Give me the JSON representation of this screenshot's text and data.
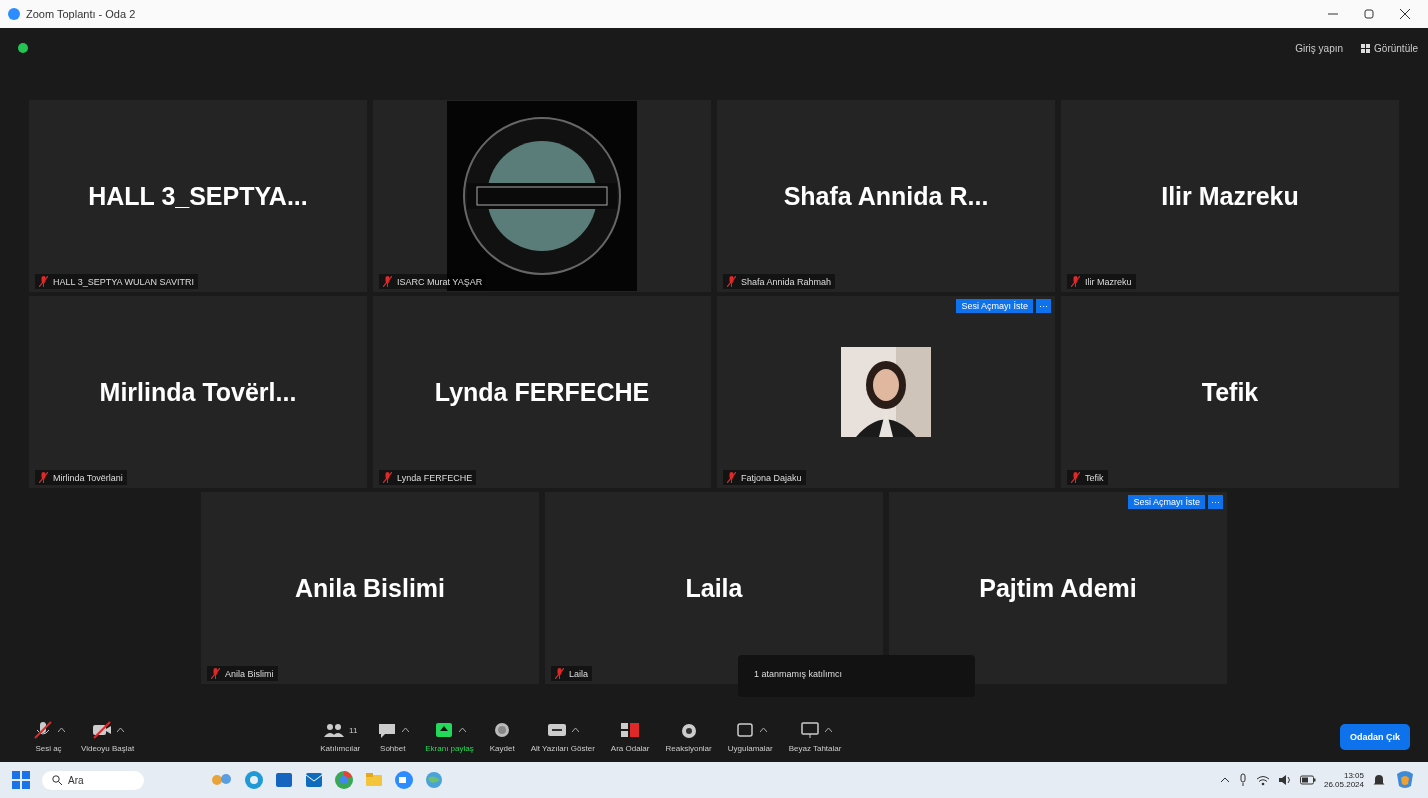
{
  "window": {
    "title": "Zoom Toplantı - Oda 2"
  },
  "top_bar": {
    "sign_in": "Giriş yapın",
    "view": "Görüntüle"
  },
  "rows": [
    [
      {
        "kind": "name",
        "display": "HALL 3_SEPTYA...",
        "label": "HALL 3_SEPTYA WULAN SAVITRI",
        "muted": true
      },
      {
        "kind": "picture",
        "label": "ISARC Murat YAŞAR",
        "muted": true
      },
      {
        "kind": "name",
        "display": "Shafa Annida R...",
        "label": "Shafa Annida Rahmah",
        "muted": true
      },
      {
        "kind": "name",
        "display": "Ilir Mazreku",
        "label": "Ilir Mazreku",
        "muted": true
      }
    ],
    [
      {
        "kind": "name",
        "display": "Mirlinda Tovërl...",
        "label": "Mirlinda Tovërlani",
        "muted": true
      },
      {
        "kind": "name",
        "display": "Lynda FERFECHE",
        "label": "Lynda FERFECHE",
        "muted": true
      },
      {
        "label": "Fatjona Dajaku",
        "muted": true,
        "ask_button": "Sesi Açmayı İste",
        "more": "···"
      },
      {
        "kind": "name",
        "display": "Tefik",
        "label": "Tefik",
        "muted": true
      }
    ],
    [
      {
        "kind": "name",
        "display": "Anila Bislimi",
        "label": "Anila Bislimi",
        "muted": true
      },
      {
        "kind": "name",
        "display": "Laila",
        "label": "Laila",
        "muted": true
      },
      {
        "kind": "name",
        "display": "Pajtim Ademi",
        "ask_button": "Sesi Açmayı İste",
        "more": "···"
      }
    ]
  ],
  "tooltip": "1 atanmamış katılımcı",
  "toolbar": [
    {
      "kind": "mic",
      "label": "Sesi aç",
      "caret": true
    },
    {
      "kind": "video",
      "label": "Videoyu Başlat",
      "caret": true
    },
    {
      "kind": "gap"
    },
    {
      "kind": "people",
      "label": "Katılımcılar",
      "count": "11",
      "caret": false
    },
    {
      "kind": "chat",
      "label": "Sohbet",
      "caret": true
    },
    {
      "kind": "share",
      "label": "Ekranı paylaş",
      "caret": true,
      "color": "#23d959"
    },
    {
      "kind": "record",
      "label": "Kaydet",
      "caret": false
    },
    {
      "kind": "cc",
      "label": "Alt Yazıları Göster",
      "caret": true
    },
    {
      "kind": "rooms",
      "label": "Ara Odalar",
      "caret": false
    },
    {
      "kind": "react",
      "label": "Reaksiyonlar",
      "caret": false
    },
    {
      "kind": "apps",
      "label": "Uygulamalar",
      "caret": true
    },
    {
      "kind": "board",
      "label": "Beyaz Tahtalar",
      "caret": true
    }
  ],
  "leave_button": "Odadan Çık",
  "taskbar": {
    "search": "Ara",
    "time": "13:05",
    "date": "26.05.2024"
  }
}
